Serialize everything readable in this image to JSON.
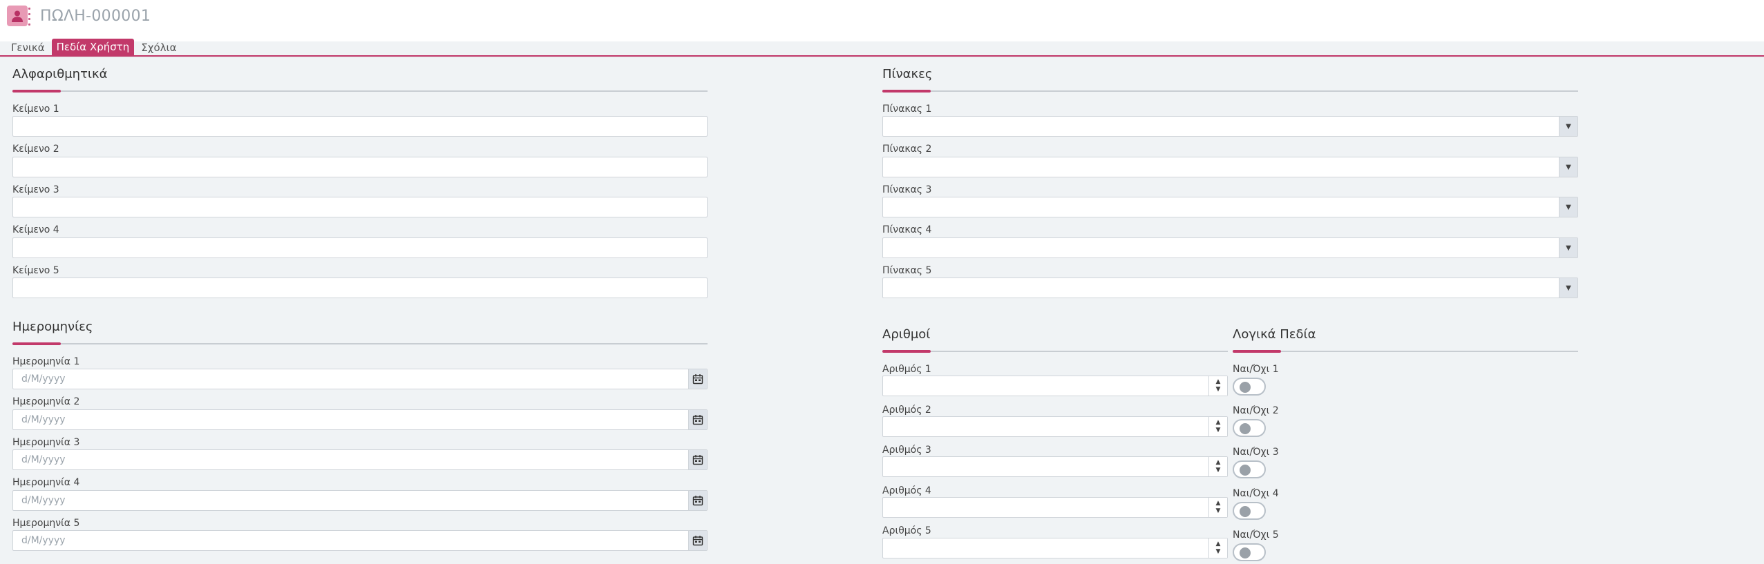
{
  "header": {
    "record_title": "ΠΩΛΗ-000001"
  },
  "tabs": [
    {
      "label": "Γενικά",
      "active": false
    },
    {
      "label": "Πεδία Χρήστη",
      "active": true
    },
    {
      "label": "Σχόλια",
      "active": false
    }
  ],
  "sections": {
    "text": {
      "title": "Αλφαριθμητικά",
      "fields": [
        {
          "label": "Κείμενο 1",
          "value": ""
        },
        {
          "label": "Κείμενο 2",
          "value": ""
        },
        {
          "label": "Κείμενο 3",
          "value": ""
        },
        {
          "label": "Κείμενο 4",
          "value": ""
        },
        {
          "label": "Κείμενο 5",
          "value": ""
        }
      ]
    },
    "tables": {
      "title": "Πίνακες",
      "fields": [
        {
          "label": "Πίνακας 1",
          "value": ""
        },
        {
          "label": "Πίνακας 2",
          "value": ""
        },
        {
          "label": "Πίνακας 3",
          "value": ""
        },
        {
          "label": "Πίνακας 4",
          "value": ""
        },
        {
          "label": "Πίνακας 5",
          "value": ""
        }
      ]
    },
    "dates": {
      "title": "Ημερομηνίες",
      "fields": [
        {
          "label": "Ημερομηνία 1",
          "placeholder": "d/M/yyyy"
        },
        {
          "label": "Ημερομηνία 2",
          "placeholder": "d/M/yyyy"
        },
        {
          "label": "Ημερομηνία 3",
          "placeholder": "d/M/yyyy"
        },
        {
          "label": "Ημερομηνία 4",
          "placeholder": "d/M/yyyy"
        },
        {
          "label": "Ημερομηνία 5",
          "placeholder": "d/M/yyyy"
        }
      ]
    },
    "numbers": {
      "title": "Αριθμοί",
      "fields": [
        {
          "label": "Αριθμός 1",
          "value": ""
        },
        {
          "label": "Αριθμός 2",
          "value": ""
        },
        {
          "label": "Αριθμός 3",
          "value": ""
        },
        {
          "label": "Αριθμός 4",
          "value": ""
        },
        {
          "label": "Αριθμός 5",
          "value": ""
        }
      ]
    },
    "booleans": {
      "title": "Λογικά Πεδία",
      "fields": [
        {
          "label": "Ναι/Όχι 1",
          "checked": false
        },
        {
          "label": "Ναι/Όχι 2",
          "checked": false
        },
        {
          "label": "Ναι/Όχι 3",
          "checked": false
        },
        {
          "label": "Ναι/Όχι 4",
          "checked": false
        },
        {
          "label": "Ναι/Όχι 5",
          "checked": false
        }
      ]
    }
  },
  "colors": {
    "accent": "#c2396a",
    "avatar": "#e89ab5",
    "background": "#f0f3f5"
  },
  "icons": {
    "avatar": "user-icon",
    "dropdown": "caret-down-icon",
    "calendar": "calendar-icon",
    "spin_up": "caret-up-icon",
    "spin_down": "caret-down-icon"
  }
}
